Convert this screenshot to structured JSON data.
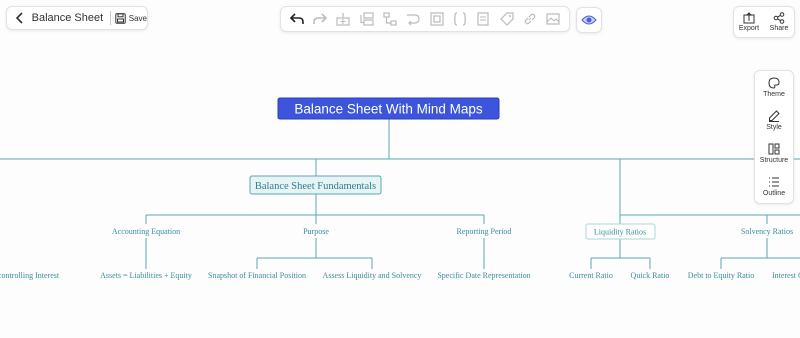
{
  "header": {
    "doc_title": "Balance Sheet ...",
    "save_label": "Save"
  },
  "toolbar": {
    "tools": [
      "undo-icon",
      "redo-icon",
      "add-child-icon",
      "add-sibling-icon",
      "relationship-icon",
      "summary-icon",
      "boundary-icon",
      "formula-icon",
      "note-icon",
      "tag-icon",
      "link-icon",
      "image-icon"
    ]
  },
  "io": {
    "export_label": "Export",
    "share_label": "Share"
  },
  "side_panel": {
    "theme_label": "Theme",
    "style_label": "Style",
    "structure_label": "Structure",
    "outline_label": "Outline"
  },
  "mindmap": {
    "root": "Balance Sheet With Mind Maps",
    "main_topic": "Balance Sheet Fundamentals",
    "subtopics": {
      "accounting_equation": "Accounting Equation",
      "purpose": "Purpose",
      "reporting_period": "Reporting Period",
      "liquidity_ratios": "Liquidity Ratios",
      "solvency_ratios": "Solvency Ratios"
    },
    "leaves": {
      "noncontrolling_interest": "controlling Interest",
      "assets_equation": "Assets = Liabilities + Equity",
      "snapshot": "Snapshot of Financial Position",
      "assess": "Assess Liquidity and Solvency",
      "specific_date": "Specific Date Representation",
      "current_ratio": "Current Ratio",
      "quick_ratio": "Quick Ratio",
      "debt_to_equity": "Debt to Equity Ratio",
      "interest": "Interest C"
    }
  },
  "colors": {
    "line": "#5aa7b2",
    "root_bg": "#3d55dc",
    "node_bg": "#e6f4f6",
    "node_border": "#5aa7b2"
  }
}
